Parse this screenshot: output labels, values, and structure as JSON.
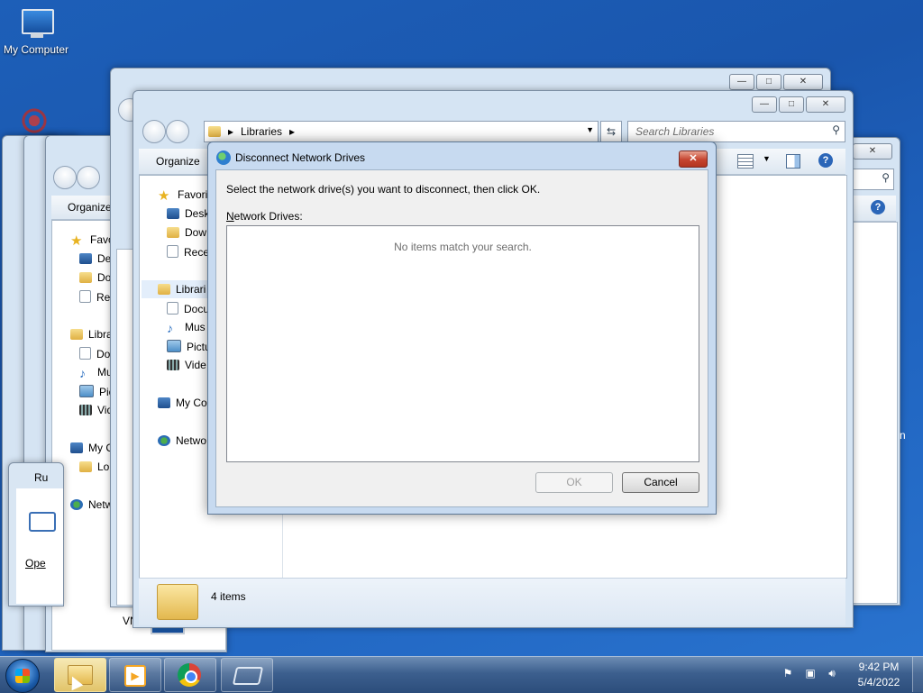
{
  "desktop": {
    "my_computer_label": "My Computer"
  },
  "explorer_front": {
    "breadcrumb_root": "Libraries",
    "search_placeholder": "Search Libraries",
    "organize_label": "Organize",
    "nav": {
      "favorites": "Favorit",
      "desktop": "Desk",
      "downloads": "Dow",
      "recent": "Rece",
      "libraries": "Librari",
      "documents": "Docu",
      "music": "Mus",
      "pictures": "Pictu",
      "videos": "Vide",
      "computer": "My Co",
      "network": "Netwo"
    },
    "status_count": "4 items"
  },
  "explorer_back": {
    "organize_label": "Organize",
    "nav": {
      "favorites": "Favo",
      "desktop": "De",
      "downloads": "Do",
      "recent": "Re",
      "libraries": "Libra",
      "documents": "Do",
      "music": "Mu",
      "pictures": "Pic",
      "videos": "Vid",
      "computer": "My C",
      "local": "Lo",
      "network": "Netw"
    },
    "vn_text": "VN",
    "run_title": "Ru",
    "run_open": "Ope",
    "edge_letter": "n"
  },
  "dialog": {
    "title": "Disconnect Network Drives",
    "prompt": "Select the network drive(s) you want to disconnect, then click OK.",
    "list_label_access": "N",
    "list_label_rest": "etwork Drives:",
    "empty_message": "No items match your search.",
    "ok_label": "OK",
    "cancel_label": "Cancel",
    "close_glyph": "✕"
  },
  "taskbar": {
    "time": "9:42 PM",
    "date": "5/4/2022"
  }
}
